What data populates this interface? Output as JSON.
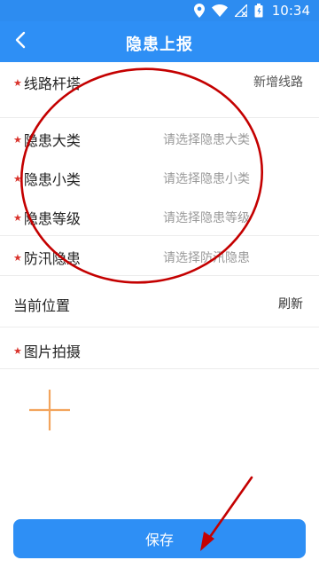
{
  "status_bar": {
    "time": "10:34",
    "icons": [
      "location-icon",
      "wifi-icon",
      "no-signal-icon",
      "battery-icon"
    ]
  },
  "header": {
    "title": "隐患上报",
    "back_icon": "chevron-left-icon"
  },
  "form": {
    "line_tower": {
      "label": "线路杆塔",
      "action": "新增线路",
      "required": true
    },
    "category_major": {
      "label": "隐患大类",
      "placeholder": "请选择隐患大类",
      "required": true
    },
    "category_minor": {
      "label": "隐患小类",
      "placeholder": "请选择隐患小类",
      "required": true
    },
    "level": {
      "label": "隐患等级",
      "placeholder": "请选择隐患等级",
      "required": true
    },
    "flood": {
      "label": "防汛隐患",
      "placeholder": "请选择防汛隐患",
      "required": true
    },
    "location": {
      "label": "当前位置",
      "action": "刷新",
      "required": false
    },
    "photo": {
      "label": "图片拍摄",
      "required": true
    }
  },
  "footer": {
    "save_label": "保存"
  },
  "colors": {
    "primary": "#2e8ff5",
    "required_star": "#d9322b",
    "annotation_red": "#c40000",
    "add_icon": "#f3a45c"
  }
}
